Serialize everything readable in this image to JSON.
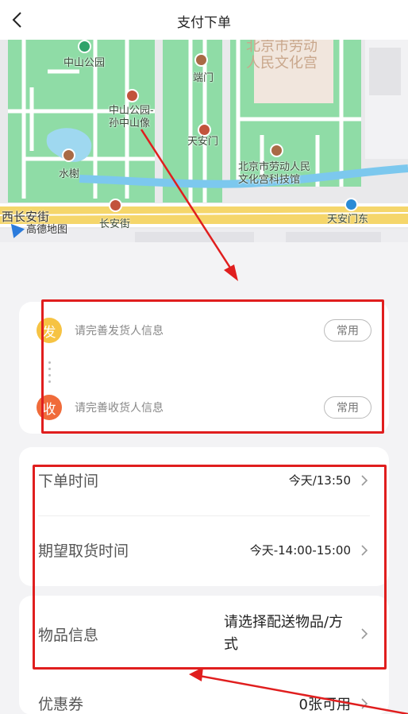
{
  "header": {
    "title": "支付下单",
    "back_icon": "chevron-left-icon"
  },
  "map": {
    "labels": {
      "zhongshan_park": "中山公园",
      "tiananmen_gate": "端门",
      "museum_top": "北京市劳动\n人民文化宫",
      "sun_statue": "中山公园-\n孙中山像",
      "tiananmen": "天安门",
      "water_pavilion": "水榭",
      "museum_sci": "北京市劳动人民\n文化宫科技馆",
      "west_changan": "西长安街",
      "changan": "长安街",
      "tiananmen_east": "天安门东"
    },
    "provider": "高德地图"
  },
  "sender": {
    "badge": "发",
    "placeholder": "请完善发货人信息",
    "common_label": "常用"
  },
  "receiver": {
    "badge": "收",
    "placeholder": "请完善收货人信息",
    "common_label": "常用"
  },
  "order": {
    "time_label": "下单时间",
    "time_value": "今天/13:50",
    "pickup_label": "期望取货时间",
    "pickup_value": "今天-14:00-15:00"
  },
  "goods": {
    "info_label": "物品信息",
    "info_value": "请选择配送物品/方式",
    "coupon_label": "优惠券",
    "coupon_value": "0张可用"
  },
  "colors": {
    "annotation": "#e01e1e",
    "send_badge": "#f6c343",
    "recv_badge": "#f06b3a",
    "map_green": "#8fdca6"
  }
}
